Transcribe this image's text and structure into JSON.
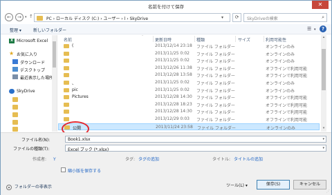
{
  "window": {
    "title": "名前を付けて保存",
    "close_glyph": "✕"
  },
  "nav": {
    "back": "←",
    "forward": "→",
    "up": "↑",
    "breadcrumb": "PC › ローカル ディスク (C:) › ユーザー › l › SkyDrive",
    "search_placeholder": "SkyDriveの検索",
    "search_icon": "search-icon"
  },
  "toolbar": {
    "organize": "整理 ▾",
    "new_folder": "新しいフォルダー",
    "help": "?"
  },
  "sidebar": {
    "items": [
      {
        "label": "Microsoft Excel",
        "icon": "excel-icon"
      },
      {
        "label": "お気に入り",
        "icon": "star-icon"
      },
      {
        "label": "ダウンロード",
        "icon": "download-icon"
      },
      {
        "label": "デスクトップ",
        "icon": "desktop-icon"
      },
      {
        "label": "最近表示した場所",
        "icon": "recent-icon"
      },
      {
        "label": "SkyDrive",
        "icon": "skydrive-icon"
      }
    ]
  },
  "file_list": {
    "columns": [
      "名前",
      "更新日時",
      "種類",
      "サイズ",
      "利用可能性"
    ],
    "rows": [
      {
        "name": "(",
        "date": "2013/12/14 23:18",
        "type": "ファイル フォルダー",
        "avail": "オンラインのみ"
      },
      {
        "name": "",
        "date": "2013/11/25 0:02",
        "type": "ファイル フォルダー",
        "avail": "オンラインのみ"
      },
      {
        "name": "",
        "date": "2013/11/25 0:02",
        "type": "ファイル フォルダー",
        "avail": "オンラインのみ"
      },
      {
        "name": "",
        "date": "2013/12/26 11:38",
        "type": "ファイル フォルダー",
        "avail": "オフラインで利用可能"
      },
      {
        "name": "",
        "date": "2013/12/28 13:58",
        "type": "ファイル フォルダー",
        "avail": "オフラインで利用可能"
      },
      {
        "name": "、",
        "date": "2013/11/25 0:02",
        "type": "ファイル フォルダー",
        "avail": "オンラインのみ"
      },
      {
        "name": "pic",
        "date": "2013/11/25 0:02",
        "type": "ファイル フォルダー",
        "avail": "オンラインのみ"
      },
      {
        "name": "Pictures",
        "date": "2013/12/28 14:30",
        "type": "ファイル フォルダー",
        "avail": "オフラインで利用可能"
      },
      {
        "name": "",
        "date": "2013/12/28 18:23",
        "type": "ファイル フォルダー",
        "avail": "オフラインで利用可能"
      },
      {
        "name": "",
        "date": "2013/12/28 14:30",
        "type": "ファイル フォルダー",
        "avail": "オフラインで利用可能"
      },
      {
        "name": "",
        "date": "2013/12/29 0:03",
        "type": "ファイル フォルダー",
        "avail": "オフラインで利用可能"
      },
      {
        "name": "公開",
        "date": "2013/11/24 23:58",
        "type": "ファイル フォルダー",
        "avail": "オンラインのみ"
      }
    ],
    "selected_index": 11
  },
  "save": {
    "filename_label": "ファイル名(N):",
    "filename_value": "Book1.xlsx",
    "filetype_label": "ファイルの種類(T):",
    "filetype_value": "Excel ブック (*.xlsx)",
    "author_label": "作成者:",
    "author_value": "Y",
    "tags_label": "タグ:",
    "tags_value": "タグの追加",
    "title_label": "タイトル:",
    "title_value": "タイトルの追加",
    "thumbnail_label": "縮小版を保存する",
    "hide_folders": "フォルダーの非表示",
    "tools": "ツール(L) ▾",
    "save_button": "保存(S)",
    "cancel_button": "キャンセル"
  },
  "colors": {
    "accent": "#1f64c4",
    "selection": "#cce8ff",
    "annotation_circle": "#e2262e",
    "close_button": "#c7473b"
  }
}
